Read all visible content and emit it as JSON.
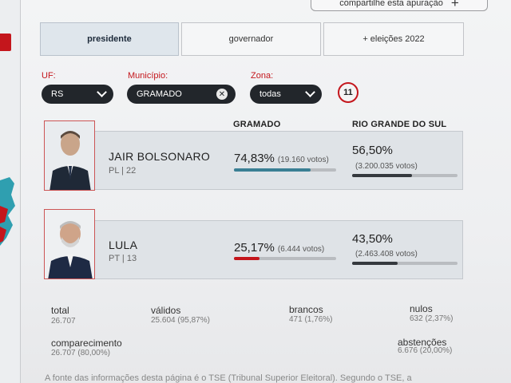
{
  "share_button": {
    "label": "compartilhe esta apuração",
    "icon": "plus-icon"
  },
  "tabs": [
    {
      "label": "presidente",
      "active": true
    },
    {
      "label": "governador",
      "active": false
    },
    {
      "label": "+ eleições 2022",
      "active": false
    }
  ],
  "filters": {
    "uf": {
      "label": "UF:",
      "value": "RS"
    },
    "municipio": {
      "label": "Município:",
      "value": "GRAMADO"
    },
    "zona": {
      "label": "Zona:",
      "value": "todas"
    },
    "count_badge": "11"
  },
  "columns": {
    "local": "GRAMADO",
    "state": "RIO GRANDE DO SUL"
  },
  "candidates": [
    {
      "name": "JAIR BOLSONARO",
      "party": "PL | 22",
      "local_pct": "74,83%",
      "local_votes": "(19.160 votos)",
      "local_share": 0.7483,
      "state_pct": "56,50%",
      "state_votes": "(3.200.035 votos)",
      "state_share": 0.565,
      "bar_color": "#3a7f94",
      "state_bar_color": "#35393e"
    },
    {
      "name": "LULA",
      "party": "PT | 13",
      "local_pct": "25,17%",
      "local_votes": "(6.444 votos)",
      "local_share": 0.2517,
      "state_pct": "43,50%",
      "state_votes": "(2.463.408 votos)",
      "state_share": 0.435,
      "bar_color": "#c4161c",
      "state_bar_color": "#35393e"
    }
  ],
  "stats": {
    "total": {
      "label": "total",
      "value": "26.707"
    },
    "validos": {
      "label": "válidos",
      "value": "25.604 (95,87%)"
    },
    "brancos": {
      "label": "brancos",
      "value": "471 (1,76%)"
    },
    "nulos": {
      "label": "nulos",
      "value": "632 (2,37%)"
    },
    "comparecimento": {
      "label": "comparecimento",
      "value": "26.707 (80,00%)"
    },
    "abstencoes": {
      "label": "abstenções",
      "value": "6.676 (20,00%)"
    }
  },
  "footnote": "A fonte das informações desta página é o TSE (Tribunal Superior Eleitoral). Segundo o TSE, a",
  "colors": {
    "accent": "#c4161c",
    "pill": "#22262b"
  }
}
